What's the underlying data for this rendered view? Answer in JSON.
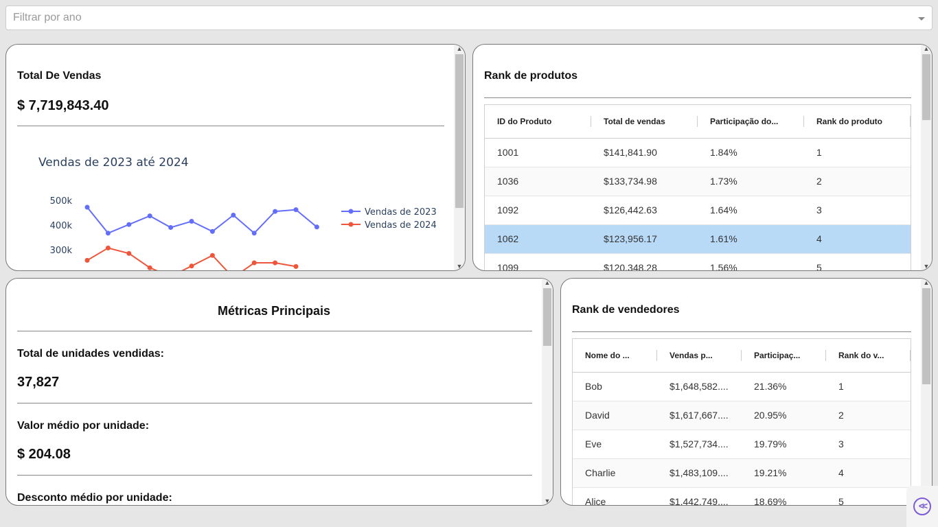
{
  "filter": {
    "placeholder": "Filtrar por ano"
  },
  "sales_card": {
    "title": "Total De Vendas",
    "total": "$ 7,719,843.40"
  },
  "chart_data": {
    "type": "line",
    "title": "Vendas de 2023 até 2024",
    "y_ticks": [
      "500k",
      "400k",
      "300k"
    ],
    "ylim": [
      150000,
      500000
    ],
    "legend": "top-right",
    "grid": false,
    "series": [
      {
        "name": "Vendas de 2023",
        "color": "#636efa",
        "values": [
          475000,
          370000,
          405000,
          440000,
          393000,
          418000,
          377000,
          443000,
          370000,
          458000,
          465000,
          395000
        ]
      },
      {
        "name": "Vendas de 2024",
        "color": "#ef553b",
        "values": [
          260000,
          310000,
          288000,
          230000,
          195000,
          237000,
          280000,
          190000,
          250000,
          250000,
          235000
        ]
      }
    ]
  },
  "products": {
    "title": "Rank de produtos",
    "columns": [
      "ID do Produto",
      "Total de vendas",
      "Participação do...",
      "Rank do produto"
    ],
    "rows": [
      [
        "1001",
        "$141,841.90",
        "1.84%",
        "1"
      ],
      [
        "1036",
        "$133,734.98",
        "1.73%",
        "2"
      ],
      [
        "1092",
        "$126,442.63",
        "1.64%",
        "3"
      ],
      [
        "1062",
        "$123,956.17",
        "1.61%",
        "4"
      ],
      [
        "1099",
        "$120,348.28",
        "1.56%",
        "5"
      ]
    ]
  },
  "metrics": {
    "title": "Métricas Principais",
    "units_label": "Total de unidades vendidas:",
    "units_value": "37,827",
    "avg_label": "Valor médio por unidade:",
    "avg_value": "$ 204.08",
    "discount_label": "Desconto médio por unidade:"
  },
  "sellers": {
    "title": "Rank de vendedores",
    "columns": [
      "Nome do ...",
      "Vendas p...",
      "Participaç...",
      "Rank do v..."
    ],
    "rows": [
      [
        "Bob",
        "$1,648,582....",
        "21.36%",
        "1"
      ],
      [
        "David",
        "$1,617,667....",
        "20.95%",
        "2"
      ],
      [
        "Eve",
        "$1,527,734....",
        "19.79%",
        "3"
      ],
      [
        "Charlie",
        "$1,483,109....",
        "19.21%",
        "4"
      ],
      [
        "Alice",
        "$1,442,749....",
        "18.69%",
        "5"
      ]
    ]
  }
}
